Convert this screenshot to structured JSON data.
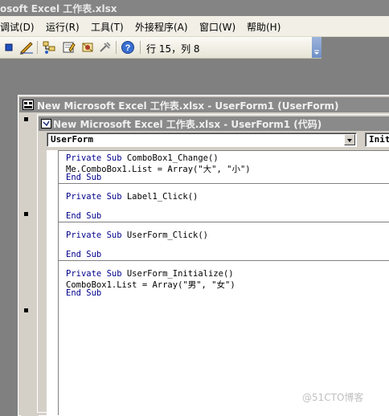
{
  "app": {
    "title": "osoft Excel 工作表.xlsx"
  },
  "menu": [
    {
      "label": "调试(D)"
    },
    {
      "label": "运行(R)"
    },
    {
      "label": "工具(T)"
    },
    {
      "label": "外接程序(A)"
    },
    {
      "label": "窗口(W)"
    },
    {
      "label": "帮助(H)"
    }
  ],
  "toolbar": {
    "position_text": "行 15，列 8",
    "icons": [
      "stop-icon",
      "design-mode-icon",
      "project-explorer-icon",
      "properties-icon",
      "toolbox-icon",
      "help-icon"
    ]
  },
  "userform_window": {
    "title": "New Microsoft Excel 工作表.xlsx - UserForm1 (UserForm)"
  },
  "code_window": {
    "title": "New Microsoft Excel 工作表.xlsx - UserForm1 (代码)",
    "object_combo": "UserForm",
    "procedure_combo": "Initi",
    "procedures": [
      {
        "lines": [
          {
            "kw": "Private Sub ",
            "rest": "ComboBox1_Change()"
          },
          {
            "kw": "",
            "rest": "Me.ComboBox1.List = Array(\"大\", \"小\")"
          },
          {
            "kw": "End Sub",
            "rest": ""
          }
        ]
      },
      {
        "lines": [
          {
            "kw": "Private Sub ",
            "rest": "Label1_Click()"
          },
          {
            "kw": "",
            "rest": ""
          },
          {
            "kw": "End Sub",
            "rest": ""
          }
        ]
      },
      {
        "lines": [
          {
            "kw": "Private Sub ",
            "rest": "UserForm_Click()"
          },
          {
            "kw": "",
            "rest": ""
          },
          {
            "kw": "End Sub",
            "rest": ""
          }
        ]
      },
      {
        "lines": [
          {
            "kw": "Private Sub ",
            "rest": "UserForm_Initialize()"
          },
          {
            "kw": "",
            "rest": "ComboBox1.List = Array(\"男\", \"女\")"
          },
          {
            "kw": "End Sub",
            "rest": ""
          }
        ]
      }
    ]
  },
  "watermark": "@51CTO博客"
}
